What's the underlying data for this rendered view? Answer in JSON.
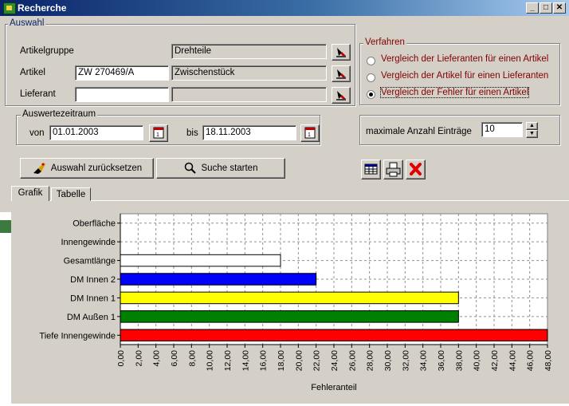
{
  "window": {
    "title": "Recherche"
  },
  "auswahl": {
    "legend": "Auswahl",
    "artikelgruppe": {
      "label": "Artikelgruppe",
      "name": "Drehteile"
    },
    "artikel": {
      "label": "Artikel",
      "code": "ZW 270469/A",
      "name": "Zwischenstück"
    },
    "lieferant": {
      "label": "Lieferant",
      "code": "",
      "name": ""
    }
  },
  "verfahren": {
    "legend": "Verfahren",
    "options": [
      {
        "label": "Vergleich der Lieferanten für einen Artikel",
        "selected": false
      },
      {
        "label": "Vergleich der Artikel für einen Lieferanten",
        "selected": false
      },
      {
        "label": "Vergleich der Fehler für einen Artikel",
        "selected": true
      }
    ]
  },
  "zeitraum": {
    "legend": "Auswertezeitraum",
    "von_label": "von",
    "von": "01.01.2003",
    "bis_label": "bis",
    "bis": "18.11.2003"
  },
  "max_entries": {
    "label": "maximale Anzahl Einträge",
    "value": "10"
  },
  "buttons": {
    "reset": "Auswahl zurücksetzen",
    "search": "Suche starten"
  },
  "tabs": [
    {
      "label": "Grafik",
      "active": true
    },
    {
      "label": "Tabelle",
      "active": false
    }
  ],
  "colors": {
    "title_start": "#0a246a",
    "title_end": "#a6caf0",
    "radio_label": "#800000"
  },
  "chart_data": {
    "type": "bar",
    "orientation": "horizontal",
    "categories": [
      "Oberfläche",
      "Innengewinde",
      "Gesamtlänge",
      "DM Innen 2",
      "DM Innen 1",
      "DM Außen 1",
      "Tiefe Innengewinde"
    ],
    "values": [
      0,
      0,
      18,
      22,
      38,
      38,
      48
    ],
    "bar_colors": [
      "#ffffff",
      "#ffffff",
      "#ffffff",
      "#0000ff",
      "#ffff00",
      "#008000",
      "#ff0000"
    ],
    "xlabel": "Fehleranteil",
    "xlim": [
      0,
      48
    ],
    "xtick_step": 2,
    "xtick_labels": [
      "0,00",
      "2,00",
      "4,00",
      "6,00",
      "8,00",
      "10,00",
      "12,00",
      "14,00",
      "16,00",
      "18,00",
      "20,00",
      "22,00",
      "24,00",
      "26,00",
      "28,00",
      "30,00",
      "32,00",
      "34,00",
      "36,00",
      "38,00",
      "40,00",
      "42,00",
      "44,00",
      "46,00",
      "48,00"
    ],
    "grid": true
  }
}
